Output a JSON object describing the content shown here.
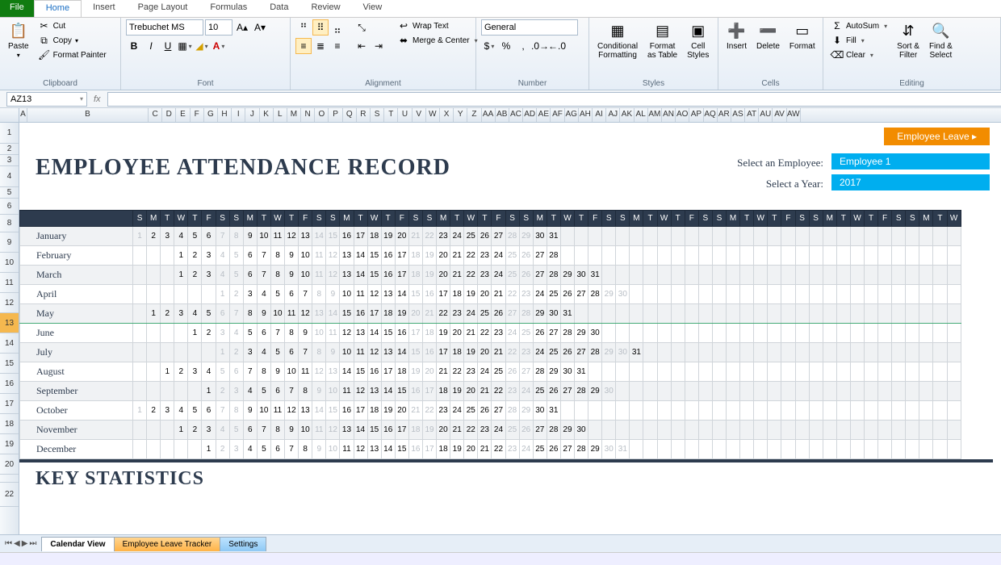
{
  "menu": {
    "file": "File",
    "tabs": [
      "Home",
      "Insert",
      "Page Layout",
      "Formulas",
      "Data",
      "Review",
      "View"
    ],
    "active": "Home"
  },
  "ribbon": {
    "clipboard": {
      "label": "Clipboard",
      "paste": "Paste",
      "cut": "Cut",
      "copy": "Copy",
      "format_painter": "Format Painter"
    },
    "font": {
      "label": "Font",
      "name": "Trebuchet MS",
      "size": "10"
    },
    "alignment": {
      "label": "Alignment",
      "wrap": "Wrap Text",
      "merge": "Merge & Center"
    },
    "number": {
      "label": "Number",
      "format": "General"
    },
    "styles": {
      "label": "Styles",
      "cond": "Conditional\nFormatting",
      "table": "Format\nas Table",
      "cell": "Cell\nStyles"
    },
    "cells": {
      "label": "Cells",
      "insert": "Insert",
      "delete": "Delete",
      "format": "Format"
    },
    "editing": {
      "label": "Editing",
      "autosum": "AutoSum",
      "fill": "Fill",
      "clear": "Clear",
      "sort": "Sort &\nFilter",
      "find": "Find &\nSelect"
    }
  },
  "namebox": "AZ13",
  "columns": [
    "A",
    "B",
    "C",
    "D",
    "E",
    "F",
    "G",
    "H",
    "I",
    "J",
    "K",
    "L",
    "M",
    "N",
    "O",
    "P",
    "Q",
    "R",
    "S",
    "T",
    "U",
    "V",
    "W",
    "X",
    "Y",
    "Z",
    "AA",
    "AB",
    "AC",
    "AD",
    "AE",
    "AF",
    "AG",
    "AH",
    "AI",
    "AJ",
    "AK",
    "AL",
    "AM",
    "AN",
    "AO",
    "AP",
    "AQ",
    "AR",
    "AS",
    "AT",
    "AU",
    "AV",
    "AW"
  ],
  "rows": [
    {
      "n": "1",
      "h": 26
    },
    {
      "n": "2",
      "h": 14
    },
    {
      "n": "3",
      "h": 14
    },
    {
      "n": "4",
      "h": 26
    },
    {
      "n": "5",
      "h": 14
    },
    {
      "n": "6",
      "h": 20
    },
    {
      "n": "8",
      "h": 22
    },
    {
      "n": "9",
      "h": 25
    },
    {
      "n": "10",
      "h": 25
    },
    {
      "n": "11",
      "h": 25
    },
    {
      "n": "12",
      "h": 25
    },
    {
      "n": "13",
      "h": 25
    },
    {
      "n": "14",
      "h": 25
    },
    {
      "n": "15",
      "h": 25
    },
    {
      "n": "16",
      "h": 25
    },
    {
      "n": "17",
      "h": 25
    },
    {
      "n": "18",
      "h": 25
    },
    {
      "n": "19",
      "h": 25
    },
    {
      "n": "20",
      "h": 25
    },
    {
      "n": "",
      "h": 10
    },
    {
      "n": "22",
      "h": 30
    }
  ],
  "selected_row": "13",
  "employee_leave_btn": "Employee Leave ▸",
  "title": "EMPLOYEE ATTENDANCE RECORD",
  "select_employee_label": "Select an Employee:",
  "select_employee_value": "Employee 1",
  "select_year_label": "Select a Year:",
  "select_year_value": "2017",
  "day_headers": [
    "S",
    "M",
    "T",
    "W",
    "T",
    "F",
    "S"
  ],
  "months": [
    {
      "name": "January",
      "offset": 0,
      "days": 31,
      "weekend_first": 0
    },
    {
      "name": "February",
      "offset": 3,
      "days": 28,
      "weekend_first": 4
    },
    {
      "name": "March",
      "offset": 3,
      "days": 31,
      "weekend_first": 4
    },
    {
      "name": "April",
      "offset": 6,
      "days": 30,
      "weekend_first": 1
    },
    {
      "name": "May",
      "offset": 1,
      "days": 31,
      "weekend_first": 6
    },
    {
      "name": "June",
      "offset": 4,
      "days": 30,
      "weekend_first": 3
    },
    {
      "name": "July",
      "offset": 6,
      "days": 31,
      "weekend_first": 1
    },
    {
      "name": "August",
      "offset": 2,
      "days": 31,
      "weekend_first": 5
    },
    {
      "name": "September",
      "offset": 5,
      "days": 30,
      "weekend_first": 2
    },
    {
      "name": "October",
      "offset": 0,
      "days": 31,
      "weekend_first": 0
    },
    {
      "name": "November",
      "offset": 3,
      "days": 30,
      "weekend_first": 4
    },
    {
      "name": "December",
      "offset": 5,
      "days": 31,
      "weekend_first": 2
    }
  ],
  "key_stats": "KEY STATISTICS",
  "sheet_tabs": [
    {
      "name": "Calendar View",
      "cls": "active"
    },
    {
      "name": "Employee Leave Tracker",
      "cls": "orange"
    },
    {
      "name": "Settings",
      "cls": "blue"
    }
  ]
}
